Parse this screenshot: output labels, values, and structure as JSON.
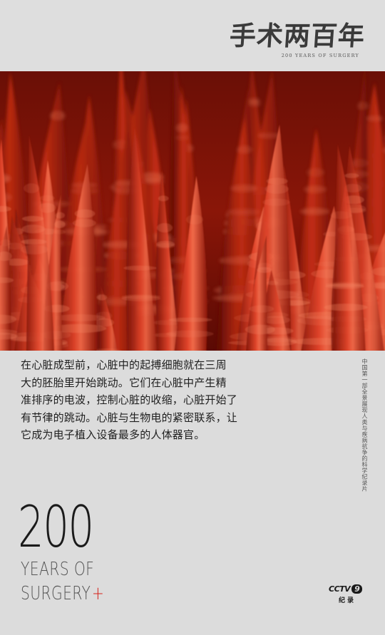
{
  "header": {
    "title": "手术两百年",
    "subtitle": "200 YEARS OF SURGERY"
  },
  "hero": {
    "subject": "cardiac-tissue-macro-image",
    "colors": {
      "deep": "#4a0804",
      "mid": "#b8240f",
      "bright": "#e5482a",
      "highlight": "#f27a5a"
    }
  },
  "body": {
    "lines": [
      "在心脏成型前，心脏中的起搏细胞就在三周",
      "大的胚胎里开始跳动。它们在心脏中产生精",
      "准排序的电波，控制心脏的收缩，心脏开始了",
      "有节律的跳动。心脏与生物电的紧密联系，让",
      "它成为电子植入设备最多的人体器官。"
    ]
  },
  "side_tagline": "中国第一部全景展现人类与疾病抗争的科学纪录片",
  "branding": {
    "big_number": "200",
    "line1": "YEARS OF",
    "line2": "SURGERY",
    "plus": "+",
    "accent": "#d6221a"
  },
  "channel": {
    "name": "CCTV",
    "number": "9",
    "sub": "纪录"
  }
}
